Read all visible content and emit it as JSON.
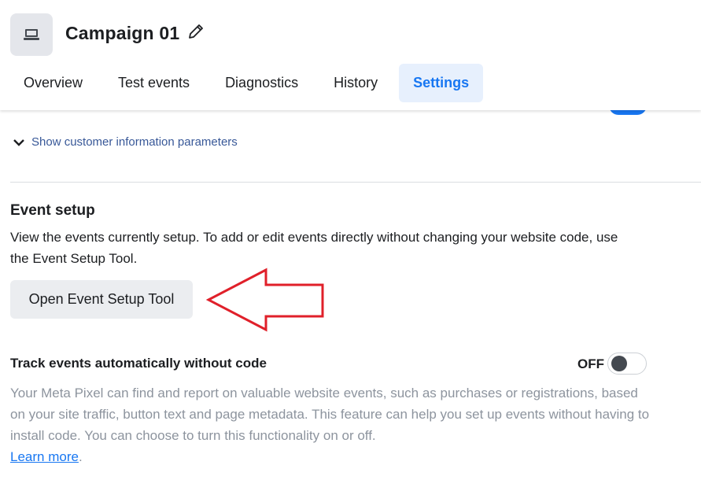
{
  "header": {
    "title": "Campaign 01",
    "icon": "laptop-icon",
    "edit_icon": "pencil-icon",
    "tabs": [
      {
        "label": "Overview",
        "active": false
      },
      {
        "label": "Test events",
        "active": false
      },
      {
        "label": "Diagnostics",
        "active": false
      },
      {
        "label": "History",
        "active": false
      },
      {
        "label": "Settings",
        "active": true
      }
    ]
  },
  "customer_params": {
    "label": "Show customer information parameters",
    "icon": "chevron-down-icon"
  },
  "event_setup": {
    "heading": "Event setup",
    "description": "View the events currently setup. To add or edit events directly without changing your website code, use the Event Setup Tool.",
    "button_label": "Open Event Setup Tool"
  },
  "auto_tracking": {
    "heading": "Track events automatically without code",
    "toggle_state": "OFF",
    "description": "Your Meta Pixel can find and report on valuable website events, such as purchases or registrations, based on your site traffic, button text and page metadata. This feature can help you set up events without having to install code. You can choose to turn this functionality on or off.",
    "link_label": "Learn more",
    "link_suffix": "."
  },
  "colors": {
    "accent": "#1877f2",
    "link": "#385898",
    "annotation_arrow": "#e0202a",
    "muted_text": "#8d949e"
  }
}
